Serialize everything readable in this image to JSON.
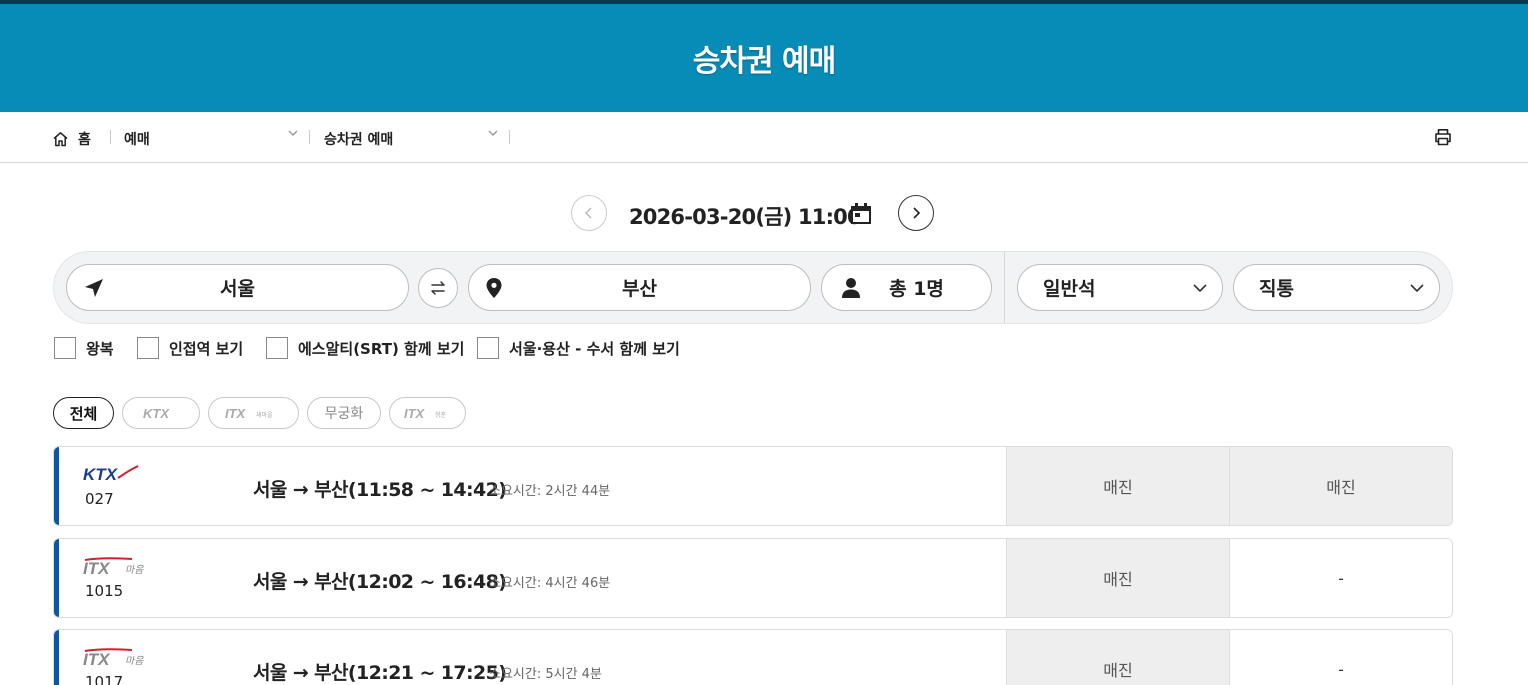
{
  "header": {
    "title": "승차권 예매"
  },
  "breadcrumb": {
    "home_label": "홈",
    "level1": "예매",
    "level2": "승차권 예매"
  },
  "date": {
    "value": "2026-03-20(금) 11:00"
  },
  "search": {
    "departure": "서울",
    "arrival": "부산",
    "passengers": "총 1명",
    "seat_class": "일반석",
    "route_type": "직통"
  },
  "options": [
    {
      "label": "왕복",
      "checked": false
    },
    {
      "label": "인접역 보기",
      "checked": false
    },
    {
      "label": "에스알티(SRT) 함께 보기",
      "checked": false
    },
    {
      "label": "서울·용산 - 수서 함께 보기",
      "checked": false
    }
  ],
  "filters": {
    "all_label": "전체",
    "chips": [
      "KTX",
      "ITX 새마을",
      "무궁화",
      "ITX 청춘"
    ],
    "mugunghwa_label": "무궁화"
  },
  "trains": [
    {
      "logo": "KTX",
      "number": "027",
      "route": "서울 → 부산(11:58 ~ 14:42)",
      "duration": "소요시간: 2시간 44분",
      "seat1": "매진",
      "seat2": "매진"
    },
    {
      "logo": "ITX 마음",
      "number": "1015",
      "route": "서울 → 부산(12:02 ~ 16:48)",
      "duration": "소요시간: 4시간 46분",
      "seat1": "매진",
      "seat2": "-"
    },
    {
      "logo": "ITX 마음",
      "number": "1017",
      "route": "서울 → 부산(12:21 ~ 17:25)",
      "duration": "소요시간: 5시간 4분",
      "seat1": "매진",
      "seat2": "-"
    }
  ],
  "colors": {
    "header_bg": "#078cb8",
    "accent": "#0a56a8",
    "sold_out_bg": "#eeeeee"
  }
}
